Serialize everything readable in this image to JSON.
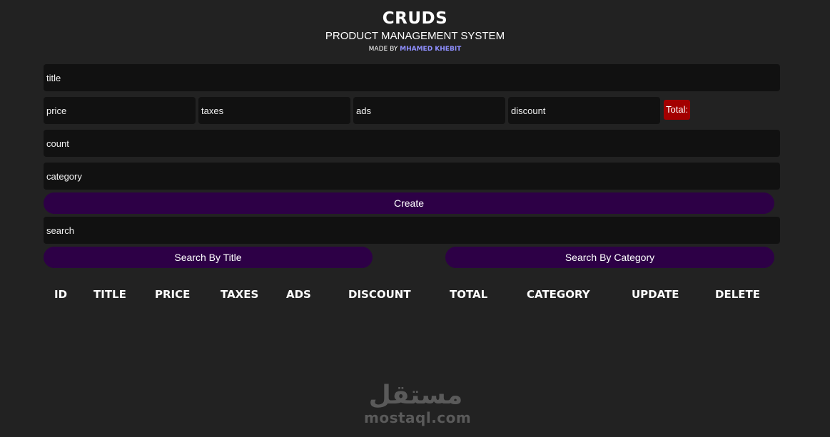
{
  "header": {
    "title": "CRUDS",
    "subtitle": "PRODUCT MANAGEMENT SYSTEM",
    "credit_prefix": "MADE BY",
    "credit_author": "MHAMED KHEBIT"
  },
  "form": {
    "title_placeholder": "title",
    "price_placeholder": "price",
    "taxes_placeholder": "taxes",
    "ads_placeholder": "ads",
    "discount_placeholder": "discount",
    "total_label": "Total:",
    "count_placeholder": "count",
    "category_placeholder": "category",
    "create_label": "Create"
  },
  "search": {
    "placeholder": "search",
    "by_title_label": "Search By Title",
    "by_category_label": "Search By Category"
  },
  "table": {
    "columns": [
      "ID",
      "TITLE",
      "PRICE",
      "TAXES",
      "ADS",
      "DISCOUNT",
      "TOTAL",
      "CATEGORY",
      "UPDATE",
      "DELETE"
    ],
    "rows": []
  },
  "watermark": {
    "arabic": "مستقل",
    "latin": "mostaql.com"
  },
  "colors": {
    "background": "#222222",
    "input_bg": "#111111",
    "button_bg": "#2d0046",
    "total_badge": "#a30000",
    "author_accent": "#8f8fff"
  }
}
